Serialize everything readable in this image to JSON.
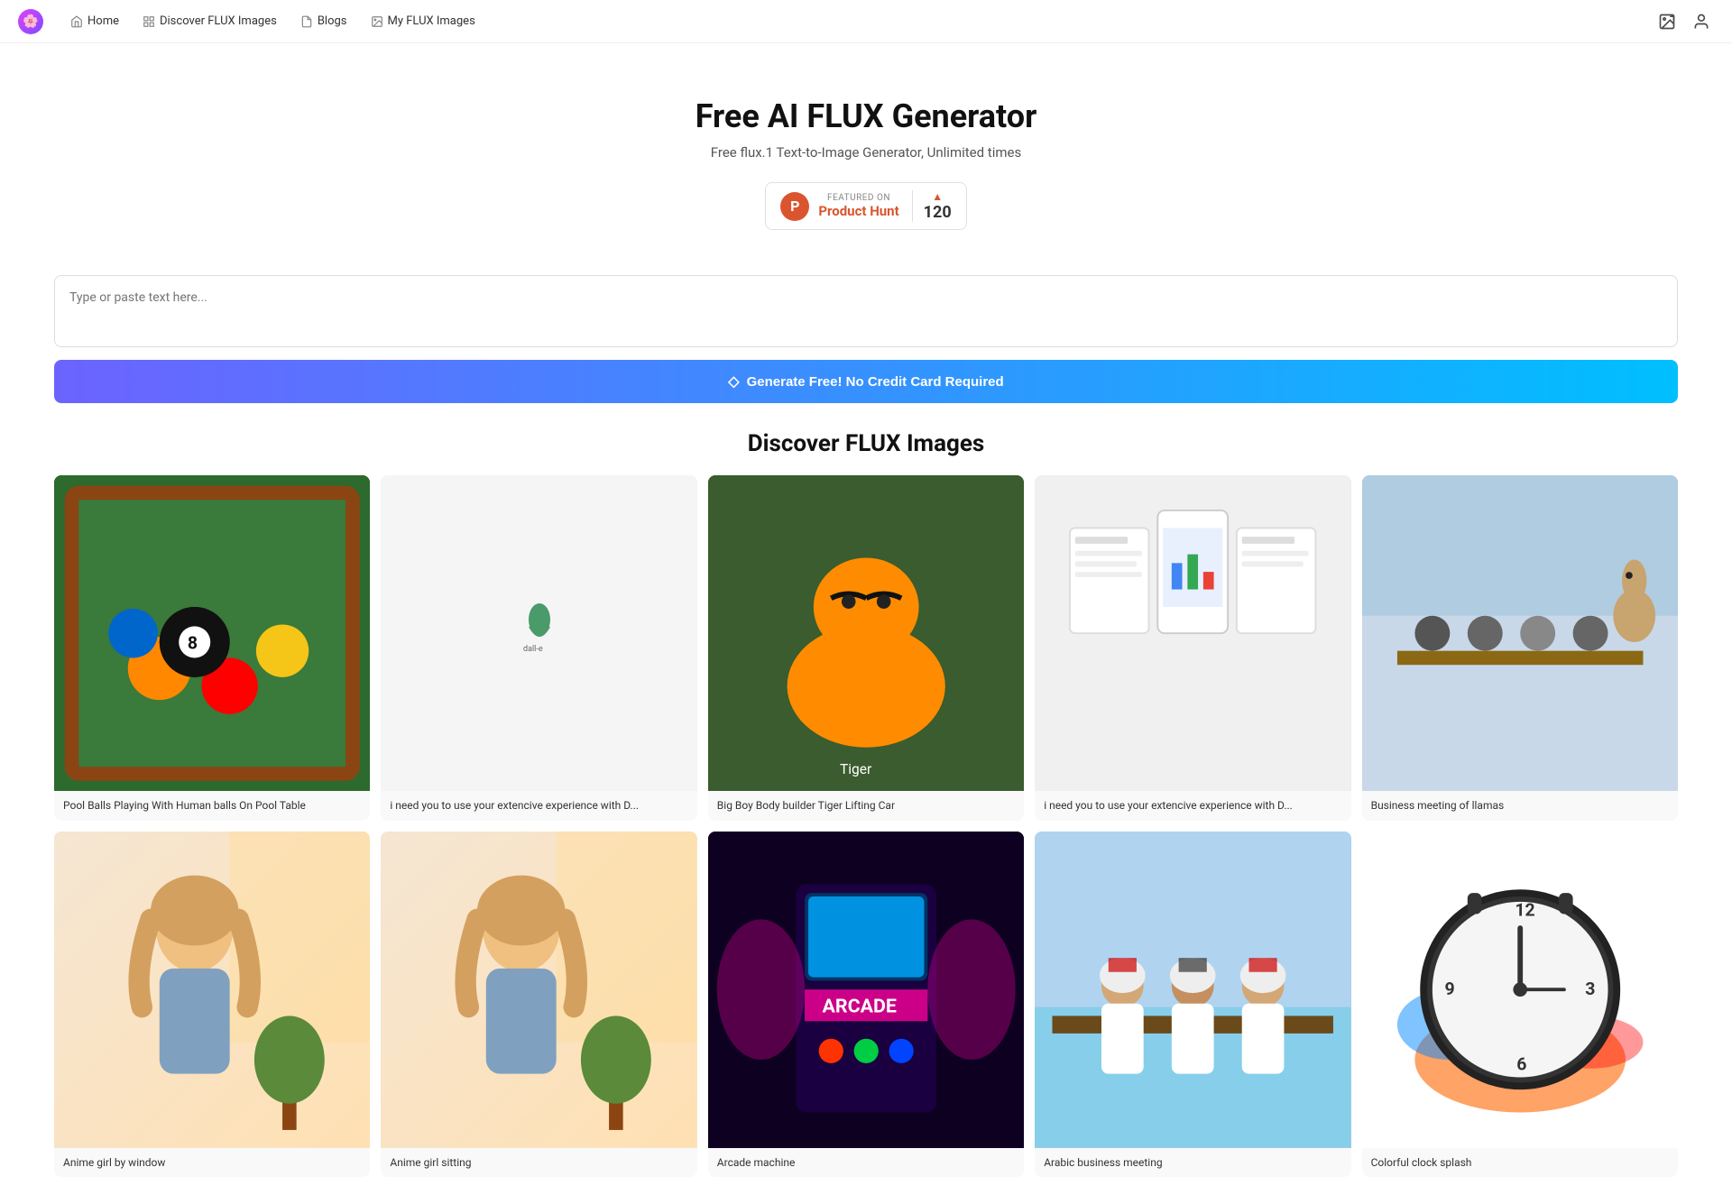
{
  "nav": {
    "logo_icon": "🌸",
    "links": [
      {
        "id": "home",
        "label": "Home",
        "icon": "home"
      },
      {
        "id": "discover",
        "label": "Discover FLUX Images",
        "icon": "grid"
      },
      {
        "id": "blogs",
        "label": "Blogs",
        "icon": "file"
      },
      {
        "id": "my-flux",
        "label": "My FLUX Images",
        "icon": "image"
      }
    ],
    "right_icons": [
      "image-upload",
      "user"
    ]
  },
  "hero": {
    "title": "Free AI FLUX Generator",
    "subtitle": "Free flux.1 Text-to-Image Generator, Unlimited times",
    "product_hunt": {
      "featured_label": "FEATURED ON",
      "name": "Product Hunt",
      "count": "120"
    }
  },
  "generator": {
    "placeholder": "Type or paste text here...",
    "button_label": "Generate Free! No Credit Card Required"
  },
  "discover": {
    "title": "Discover FLUX Images",
    "row1": [
      {
        "id": "pool",
        "label": "Pool Balls Playing With Human balls On Pool Table",
        "color": "#2d6a2d",
        "emoji": "🎱"
      },
      {
        "id": "dalle",
        "label": "i need you to use your extencive experience with D...",
        "color": "#f5f5f5",
        "emoji": "💧"
      },
      {
        "id": "tiger",
        "label": "Big Boy Body builder Tiger Lifting Car",
        "color": "#3a5c2e",
        "emoji": "🐯"
      },
      {
        "id": "phone",
        "label": "i need you to use your extencive experience with D...",
        "color": "#e8e8e8",
        "emoji": "📱"
      },
      {
        "id": "llama",
        "label": "Business meeting of llamas",
        "color": "#d0dce8",
        "emoji": "🦙"
      }
    ],
    "row2": [
      {
        "id": "anime1",
        "label": "Anime girl by window",
        "color": "#f5e6d3",
        "emoji": "👧"
      },
      {
        "id": "anime2",
        "label": "Anime girl sitting",
        "color": "#f0e8d0",
        "emoji": "👧"
      },
      {
        "id": "arcade",
        "label": "Arcade machine",
        "color": "#1a0030",
        "emoji": "🕹️"
      },
      {
        "id": "arabic",
        "label": "Arabic business meeting",
        "color": "#b0c8e0",
        "emoji": "🤝"
      },
      {
        "id": "clock",
        "label": "Colorful clock splash",
        "color": "#ffffff",
        "emoji": "⏰"
      }
    ]
  }
}
